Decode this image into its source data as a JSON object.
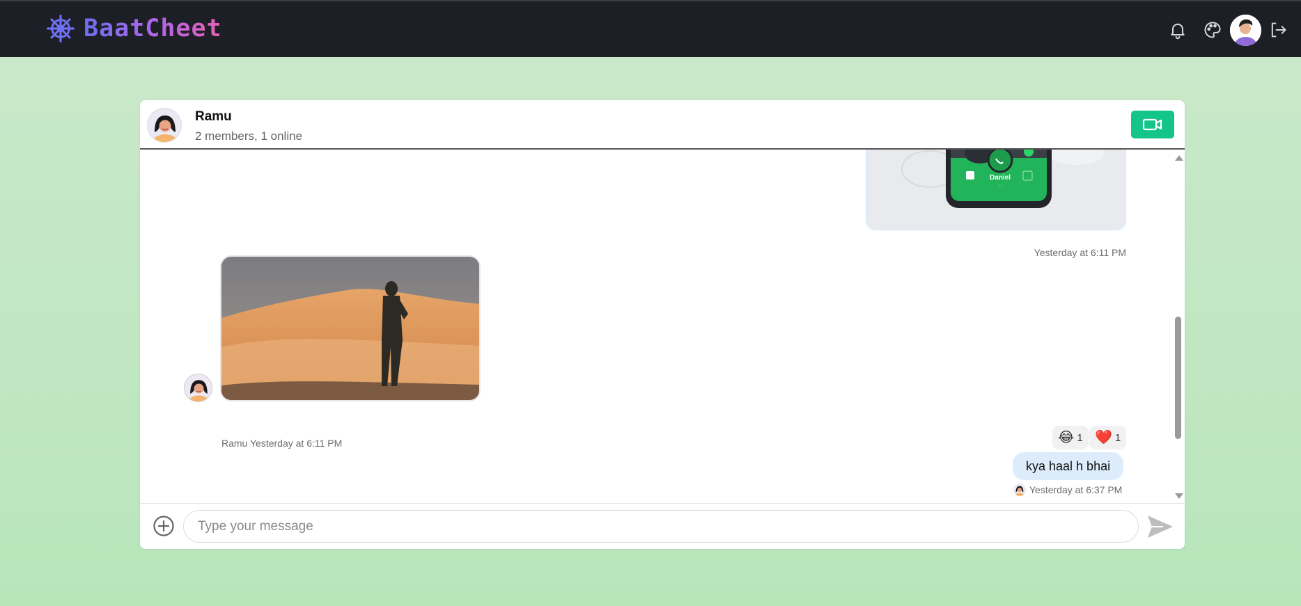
{
  "app": {
    "brand_name": "BaatCheet",
    "brand_icon": "ship-wheel-icon",
    "accent_color": "#6d6ff2"
  },
  "nav": {
    "notifications_icon": "bell-icon",
    "theme_icon": "palette-icon",
    "profile_icon": "avatar",
    "logout_icon": "logout-icon"
  },
  "chat": {
    "name": "Ramu",
    "status": "2 members, 1 online",
    "video_call_icon": "video-camera-icon",
    "video_btn_color": "#14c58a"
  },
  "messages": [
    {
      "type": "image",
      "direction": "sent",
      "preview_text": "Daniel",
      "timestamp": "Yesterday at 6:11 PM"
    },
    {
      "type": "image",
      "direction": "received",
      "sender": "Ramu",
      "timestamp": "Yesterday at 6:11 PM"
    },
    {
      "type": "text",
      "direction": "sent",
      "text": "kya haal h bhai",
      "timestamp": "Yesterday at 6:37 PM",
      "reactions": [
        {
          "emoji": "😂",
          "count": "1"
        },
        {
          "emoji": "❤️",
          "count": "1"
        }
      ]
    }
  ],
  "composer": {
    "placeholder": "Type your message",
    "value": "",
    "attach_icon": "plus-circle-icon",
    "send_icon": "send-icon"
  }
}
